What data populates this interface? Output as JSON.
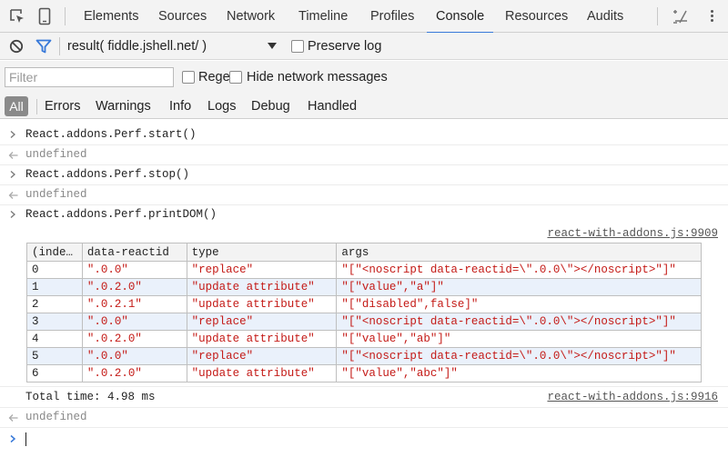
{
  "toolbar": {
    "icons": [
      "inspect-element-icon",
      "device-mode-icon",
      "warning-icon",
      "more-options-icon"
    ],
    "tabs": [
      {
        "label": "Elements"
      },
      {
        "label": "Sources"
      },
      {
        "label": "Network"
      },
      {
        "label": "Timeline"
      },
      {
        "label": "Profiles"
      },
      {
        "label": "Console",
        "active": true
      },
      {
        "label": "Resources"
      },
      {
        "label": "Audits"
      }
    ],
    "accent_color": "#3879d9"
  },
  "context_bar": {
    "context_value": "result( fiddle.jshell.net/ )",
    "preserve_log_label": "Preserve log",
    "preserve_log_checked": false
  },
  "filter_bar": {
    "placeholder": "Filter",
    "value": "",
    "regex_label": "Regex",
    "regex_checked": false,
    "hide_network_label": "Hide network messages",
    "hide_network_checked": false
  },
  "levels": {
    "all_label": "All",
    "items": [
      "Errors",
      "Warnings",
      "Info",
      "Logs",
      "Debug",
      "Handled"
    ]
  },
  "console": {
    "messages": [
      {
        "kind": "input",
        "text": "React.addons.Perf.start()"
      },
      {
        "kind": "result",
        "text": "undefined"
      },
      {
        "kind": "input",
        "text": "React.addons.Perf.stop()"
      },
      {
        "kind": "result",
        "text": "undefined"
      },
      {
        "kind": "input",
        "text": "React.addons.Perf.printDOM()"
      }
    ],
    "table_source": "react-with-addons.js:9909",
    "table": {
      "columns": [
        "(inde…",
        "data-reactid",
        "type",
        "args"
      ],
      "rows": [
        [
          "0",
          "\".0.0\"",
          "\"replace\"",
          "\"[\"<noscript data-reactid=\\\".0.0\\\"></noscript>\"]\""
        ],
        [
          "1",
          "\".0.2.0\"",
          "\"update attribute\"",
          "\"[\"value\",\"a\"]\""
        ],
        [
          "2",
          "\".0.2.1\"",
          "\"update attribute\"",
          "\"[\"disabled\",false]\""
        ],
        [
          "3",
          "\".0.0\"",
          "\"replace\"",
          "\"[\"<noscript data-reactid=\\\".0.0\\\"></noscript>\"]\""
        ],
        [
          "4",
          "\".0.2.0\"",
          "\"update attribute\"",
          "\"[\"value\",\"ab\"]\""
        ],
        [
          "5",
          "\".0.0\"",
          "\"replace\"",
          "\"[\"<noscript data-reactid=\\\".0.0\\\"></noscript>\"]\""
        ],
        [
          "6",
          "\".0.2.0\"",
          "\"update attribute\"",
          "\"[\"value\",\"abc\"]\""
        ]
      ]
    },
    "total_time": "Total time: 4.98 ms",
    "total_source": "react-with-addons.js:9916",
    "final_result": "undefined",
    "string_color": "#c41a16"
  }
}
